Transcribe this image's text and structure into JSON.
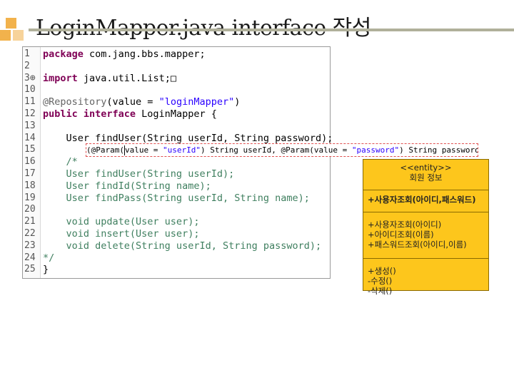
{
  "slide": {
    "title": "LoginMapper.java interface 작성"
  },
  "colors": {
    "accent_square": "#f2b24c",
    "title_rule": "#b0b09a",
    "uml_fill": "#fdc61c",
    "keyword": "#7f0055",
    "annotation": "#646464",
    "string": "#2a00ff",
    "comment": "#3f7f5f"
  },
  "editor": {
    "lines": [
      {
        "num": "1",
        "parts": [
          [
            "kw",
            "package"
          ],
          [
            "plain",
            " com.jang.bbs.mapper;"
          ]
        ]
      },
      {
        "num": "2",
        "parts": []
      },
      {
        "num": "3",
        "fold": "⊕",
        "parts": [
          [
            "kw",
            "import"
          ],
          [
            "plain",
            " java.util.List;"
          ],
          [
            "plain",
            "□"
          ]
        ]
      },
      {
        "num": "10",
        "parts": []
      },
      {
        "num": "11",
        "parts": [
          [
            "ann",
            "@Repository"
          ],
          [
            "plain",
            "(value = "
          ],
          [
            "str",
            "\"loginMapper\""
          ],
          [
            "plain",
            ")"
          ]
        ]
      },
      {
        "num": "12",
        "parts": [
          [
            "kw",
            "public interface"
          ],
          [
            "plain",
            " LoginMapper {"
          ]
        ]
      },
      {
        "num": "13",
        "parts": []
      },
      {
        "num": "14",
        "parts": [
          [
            "plain",
            "    User findUser(String userId, String password);"
          ]
        ]
      },
      {
        "num": "15",
        "parts": []
      },
      {
        "num": "16",
        "parts": [
          [
            "cmt",
            "    /*"
          ]
        ]
      },
      {
        "num": "17",
        "parts": [
          [
            "cmt",
            "    User findUser(String userId);"
          ]
        ]
      },
      {
        "num": "18",
        "parts": [
          [
            "cmt",
            "    User findId(String name);"
          ]
        ]
      },
      {
        "num": "19",
        "parts": [
          [
            "cmt",
            "    User findPass(String userId, String name);"
          ]
        ]
      },
      {
        "num": "20",
        "parts": []
      },
      {
        "num": "21",
        "parts": [
          [
            "cmt",
            "    void update(User user);"
          ]
        ]
      },
      {
        "num": "22",
        "parts": [
          [
            "cmt",
            "    void insert(User user);"
          ]
        ]
      },
      {
        "num": "23",
        "parts": [
          [
            "cmt",
            "    void delete(String userId, String password);"
          ]
        ]
      },
      {
        "num": "24",
        "parts": [
          [
            "cmt",
            "*/"
          ]
        ]
      },
      {
        "num": "25",
        "parts": [
          [
            "plain",
            "}"
          ]
        ]
      }
    ]
  },
  "snippet": {
    "parts": [
      [
        "plain",
        "(@Param("
      ],
      [
        "caret",
        ""
      ],
      [
        "plain",
        "value = "
      ],
      [
        "str",
        "\"userId\""
      ],
      [
        "plain",
        ") String userId, @Param(value = "
      ],
      [
        "str",
        "\"password\""
      ],
      [
        "plain",
        ") String password);"
      ]
    ]
  },
  "uml": {
    "stereotype": "<<entity>>",
    "name": "회원 정보",
    "primary_method": "+사용자조회(아이디,패스워드)",
    "query_methods": [
      "+사용자조회(아이디)",
      "+아이디조회(이름)",
      "+패스워드조회(아이디,이름)"
    ],
    "crud_methods": [
      "+생성()",
      "-수정()",
      "-삭제()"
    ]
  }
}
